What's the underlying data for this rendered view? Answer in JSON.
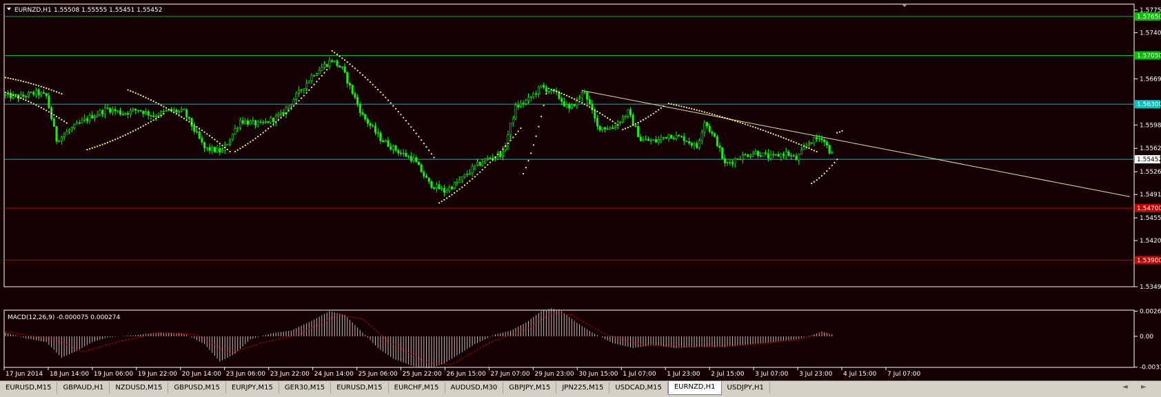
{
  "header": {
    "symbol": "EURNZD,H1",
    "ohlc": "1.55508 1.55555 1.55451 1.55452"
  },
  "macd_header": "MACD(12,26,9) -0.000075 0.000274",
  "colors": {
    "background": "#140000",
    "candle": "#00ff00",
    "sar": "#ffff80",
    "green_line": "#00c000",
    "cyan_line": "#00c0c0",
    "red_line": "#c00000",
    "trend_line": "#e8e0a0",
    "macd_hist": "#c0c0c0",
    "macd_signal": "#c00000"
  },
  "chart_data": {
    "type": "candlestick",
    "symbol": "EURNZD",
    "timeframe": "H1",
    "y_ticks": [
      "1.57750",
      "1.57400",
      "1.56690",
      "1.55980",
      "1.55620",
      "1.55260",
      "1.54910",
      "1.54550",
      "1.54200",
      "1.53490"
    ],
    "ylim": [
      1.5349,
      1.5784
    ],
    "x_labels": [
      "17 Jun 2014",
      "18 Jun 14:00",
      "19 Jun 06:00",
      "19 Jun 22:00",
      "20 Jun 14:00",
      "23 Jun 06:00",
      "23 Jun 22:00",
      "24 Jun 14:00",
      "25 Jun 06:00",
      "25 Jun 22:00",
      "26 Jun 15:00",
      "27 Jun 07:00",
      "29 Jun 23:00",
      "30 Jun 15:00",
      "1 Jul 07:00",
      "1 Jul 23:00",
      "2 Jul 15:00",
      "3 Jul 07:00",
      "3 Jul 23:00",
      "4 Jul 15:00",
      "7 Jul 07:00"
    ],
    "levels": [
      {
        "price": 1.5765,
        "label": "1.57650",
        "color": "#00c000",
        "label_bg": "#00c000"
      },
      {
        "price": 1.5705,
        "label": "1.57050",
        "color": "#00c000",
        "label_bg": "#00c000"
      },
      {
        "price": 1.563,
        "label": "1.56300",
        "color": "#00c0c0",
        "label_bg": "#00c0c0"
      },
      {
        "price": 1.55452,
        "label": "1.55452",
        "color": "#00c0c0",
        "label_bg": "#ffffff"
      },
      {
        "price": 1.547,
        "label": "1.54700",
        "color": "#c00000",
        "label_bg": "#c00000"
      },
      {
        "price": 1.539,
        "label": "1.53900",
        "color": "#c00000",
        "label_bg": "#c00000"
      }
    ],
    "trend_line": {
      "from": {
        "bar": 226,
        "price": 1.5651
      },
      "to": {
        "bar": 410,
        "price": 1.5511
      }
    },
    "keypoints": [
      [
        0,
        1.5643
      ],
      [
        6,
        1.5641
      ],
      [
        12,
        1.5648
      ],
      [
        16,
        1.5642
      ],
      [
        20,
        1.5575
      ],
      [
        28,
        1.5598
      ],
      [
        34,
        1.5612
      ],
      [
        40,
        1.5623
      ],
      [
        46,
        1.5616
      ],
      [
        52,
        1.5622
      ],
      [
        58,
        1.5612
      ],
      [
        64,
        1.562
      ],
      [
        70,
        1.5618
      ],
      [
        78,
        1.5562
      ],
      [
        85,
        1.5557
      ],
      [
        92,
        1.5605
      ],
      [
        100,
        1.5598
      ],
      [
        108,
        1.5613
      ],
      [
        115,
        1.5648
      ],
      [
        121,
        1.5678
      ],
      [
        128,
        1.5698
      ],
      [
        132,
        1.5684
      ],
      [
        140,
        1.5612
      ],
      [
        147,
        1.5577
      ],
      [
        151,
        1.5565
      ],
      [
        155,
        1.5555
      ],
      [
        160,
        1.5545
      ],
      [
        166,
        1.5508
      ],
      [
        172,
        1.5496
      ],
      [
        178,
        1.5512
      ],
      [
        184,
        1.5534
      ],
      [
        189,
        1.5546
      ],
      [
        195,
        1.5555
      ],
      [
        200,
        1.5625
      ],
      [
        205,
        1.5637
      ],
      [
        210,
        1.5657
      ],
      [
        216,
        1.5645
      ],
      [
        221,
        1.5621
      ],
      [
        227,
        1.5651
      ],
      [
        232,
        1.5595
      ],
      [
        238,
        1.5593
      ],
      [
        244,
        1.5618
      ],
      [
        249,
        1.5575
      ],
      [
        255,
        1.5573
      ],
      [
        260,
        1.5583
      ],
      [
        266,
        1.5577
      ],
      [
        271,
        1.5564
      ],
      [
        274,
        1.5604
      ],
      [
        279,
        1.557
      ],
      [
        282,
        1.5537
      ],
      [
        288,
        1.5549
      ],
      [
        294,
        1.5556
      ],
      [
        300,
        1.5548
      ],
      [
        306,
        1.5555
      ],
      [
        310,
        1.5545
      ],
      [
        315,
        1.5572
      ],
      [
        320,
        1.5579
      ],
      [
        324,
        1.5552
      ]
    ],
    "sar_segments": [
      {
        "from": [
          0,
          1.5671
        ],
        "to": [
          22,
          1.5646
        ]
      },
      {
        "from": [
          0,
          1.5648
        ],
        "to": [
          24,
          1.5601
        ]
      },
      {
        "from": [
          32,
          1.556
        ],
        "to": [
          62,
          1.5615
        ]
      },
      {
        "from": [
          48,
          1.5652
        ],
        "to": [
          88,
          1.5557
        ]
      },
      {
        "from": [
          90,
          1.5557
        ],
        "to": [
          126,
          1.5683
        ]
      },
      {
        "from": [
          128,
          1.5712
        ],
        "to": [
          168,
          1.5548
        ]
      },
      {
        "from": [
          170,
          1.5478
        ],
        "to": [
          202,
          1.5593
        ]
      },
      {
        "from": [
          203,
          1.5523
        ],
        "to": [
          212,
          1.5646
        ]
      },
      {
        "from": [
          213,
          1.5654
        ],
        "to": [
          240,
          1.5598
        ]
      },
      {
        "from": [
          242,
          1.5591
        ],
        "to": [
          258,
          1.5627
        ]
      },
      {
        "from": [
          260,
          1.5631
        ],
        "to": [
          318,
          1.5557
        ]
      },
      {
        "from": [
          316,
          1.5508
        ],
        "to": [
          326,
          1.5545
        ]
      },
      {
        "from": [
          326,
          1.5586
        ],
        "to": [
          328,
          1.5589
        ]
      }
    ],
    "macd": {
      "ylim": [
        -0.0032,
        0.0027
      ],
      "y_ticks": [
        "0.0026",
        "0.00",
        "-0.003178"
      ],
      "hist_keypoints": [
        [
          0,
          0.0004
        ],
        [
          8,
          -0.0002
        ],
        [
          16,
          -0.0006
        ],
        [
          22,
          -0.0022
        ],
        [
          28,
          -0.0015
        ],
        [
          34,
          -0.0006
        ],
        [
          40,
          -0.0001
        ],
        [
          50,
          0.0001
        ],
        [
          60,
          0.0004
        ],
        [
          70,
          0.0003
        ],
        [
          78,
          -0.0008
        ],
        [
          84,
          -0.0026
        ],
        [
          90,
          -0.0018
        ],
        [
          96,
          -0.0003
        ],
        [
          104,
          0.0003
        ],
        [
          112,
          0.0006
        ],
        [
          120,
          0.0016
        ],
        [
          127,
          0.0026
        ],
        [
          133,
          0.0022
        ],
        [
          140,
          0.0004
        ],
        [
          146,
          -0.0012
        ],
        [
          152,
          -0.0023
        ],
        [
          160,
          -0.0031
        ],
        [
          166,
          -0.0033
        ],
        [
          172,
          -0.0028
        ],
        [
          178,
          -0.0018
        ],
        [
          184,
          -0.0008
        ],
        [
          192,
          0.0002
        ],
        [
          198,
          0.0006
        ],
        [
          204,
          0.0014
        ],
        [
          210,
          0.0026
        ],
        [
          214,
          0.0029
        ],
        [
          218,
          0.0026
        ],
        [
          224,
          0.0014
        ],
        [
          230,
          0.0004
        ],
        [
          238,
          -0.0007
        ],
        [
          246,
          -0.0012
        ],
        [
          254,
          -0.0009
        ],
        [
          262,
          -0.0012
        ],
        [
          272,
          -0.0011
        ],
        [
          282,
          -0.0011
        ],
        [
          292,
          -0.0008
        ],
        [
          300,
          -0.0006
        ],
        [
          310,
          -0.0003
        ],
        [
          316,
          0.0001
        ],
        [
          320,
          0.0005
        ],
        [
          324,
          0.0002
        ]
      ],
      "signal_keypoints": [
        [
          0,
          0.0005
        ],
        [
          20,
          -0.0004
        ],
        [
          30,
          -0.0016
        ],
        [
          45,
          -0.0005
        ],
        [
          60,
          0.0003
        ],
        [
          75,
          0.0002
        ],
        [
          88,
          -0.0018
        ],
        [
          100,
          -0.0007
        ],
        [
          115,
          0.0002
        ],
        [
          130,
          0.0022
        ],
        [
          140,
          0.0018
        ],
        [
          150,
          -0.0005
        ],
        [
          165,
          -0.0027
        ],
        [
          175,
          -0.0029
        ],
        [
          190,
          -0.0006
        ],
        [
          205,
          0.0008
        ],
        [
          214,
          0.0024
        ],
        [
          222,
          0.0022
        ],
        [
          235,
          0.0002
        ],
        [
          250,
          -0.0009
        ],
        [
          270,
          -0.0011
        ],
        [
          290,
          -0.0009
        ],
        [
          310,
          -0.0004
        ],
        [
          320,
          0.0003
        ],
        [
          326,
          0.0002
        ]
      ]
    }
  },
  "tabs": [
    {
      "label": "EURUSD,M15",
      "active": false
    },
    {
      "label": "GBPAUD,H1",
      "active": false
    },
    {
      "label": "NZDUSD,M15",
      "active": false
    },
    {
      "label": "GBPUSD,M15",
      "active": false
    },
    {
      "label": "EURJPY,M15",
      "active": false
    },
    {
      "label": "GER30,M15",
      "active": false
    },
    {
      "label": "EURUSD,M15",
      "active": false
    },
    {
      "label": "EURCHF,M15",
      "active": false
    },
    {
      "label": "AUDUSD,M30",
      "active": false
    },
    {
      "label": "GBPJPY,M15",
      "active": false
    },
    {
      "label": "JPN225,M15",
      "active": false
    },
    {
      "label": "USDCAD,M15",
      "active": false
    },
    {
      "label": "EURNZD,H1",
      "active": true
    },
    {
      "label": "USDJPY,H1",
      "active": false
    }
  ],
  "nav": {
    "left": "◄",
    "right": "►"
  }
}
